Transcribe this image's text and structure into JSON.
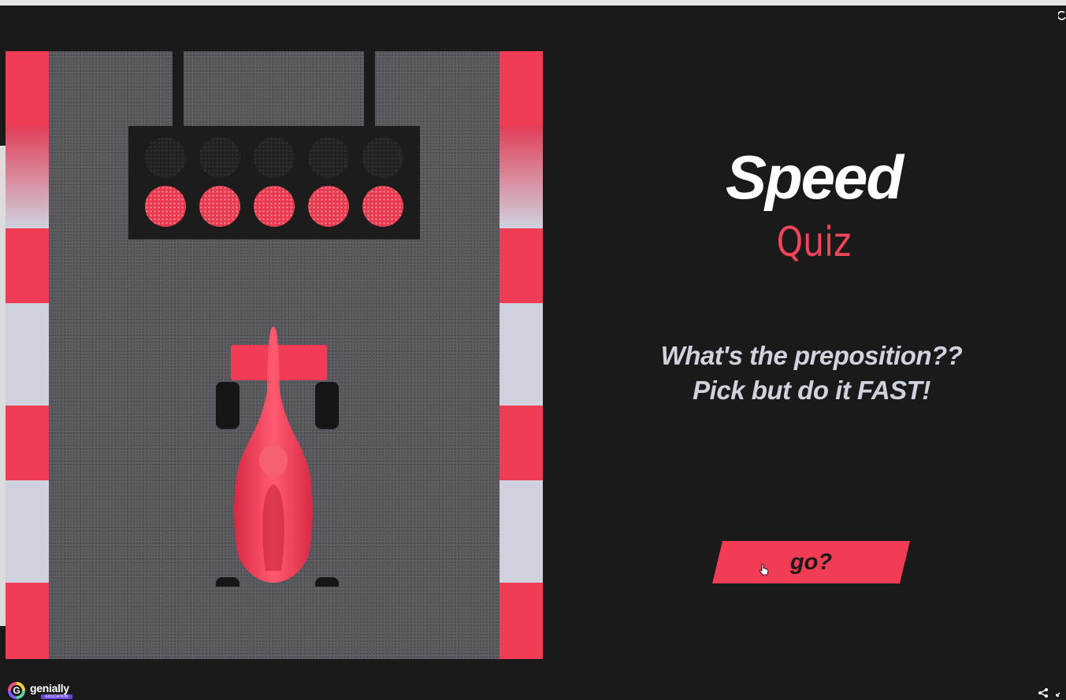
{
  "game": {
    "title_line1": "Speed",
    "title_line2": "Quiz",
    "subtitle_line1": "What's the preposition??",
    "subtitle_line2": "Pick but do it FAST!",
    "start_button_label": "go?"
  },
  "starting_lights": {
    "columns": 5,
    "top_row_state": "off",
    "bottom_row_state": "on",
    "lit_color": "#e8394e"
  },
  "branding": {
    "logo_text": "genially",
    "logo_badge": "EDUCATION"
  },
  "colors": {
    "background": "#1a1a1a",
    "accent_red": "#f23c55",
    "title_white": "#ffffff",
    "subtitle_gray": "#d0d2de",
    "curb_white": "#cfd2de",
    "asphalt": "#5a5a60"
  },
  "icons": {
    "share": "share-icon",
    "fullscreen": "expand-icon",
    "cursor": "hand-pointer-icon"
  }
}
